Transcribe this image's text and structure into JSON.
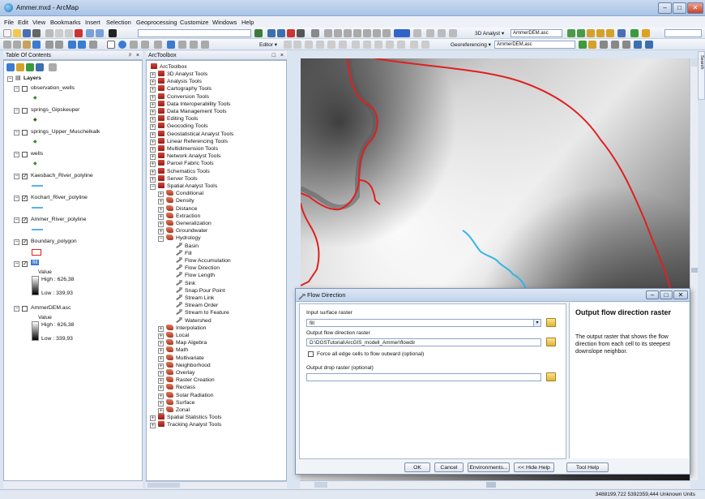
{
  "window": {
    "title": "Ammer.mxd - ArcMap"
  },
  "menu": [
    "File",
    "Edit",
    "View",
    "Bookmarks",
    "Insert",
    "Selection",
    "Geoprocessing",
    "Customize",
    "Windows",
    "Help"
  ],
  "toolbar": {
    "analyst_3d": "3D Analyst ▾",
    "layer_combo": "AmmerDEM.asc",
    "editor": "Editor ▾",
    "georeferencing": "Georeferencing ▾",
    "geo_layer": "AmmerDEM.asc"
  },
  "toc": {
    "title": "Table Of Contents",
    "root": "Layers",
    "layers": [
      {
        "name": "observation_wells",
        "checked": false,
        "symbol": "point"
      },
      {
        "name": "springs_Gipskeuper",
        "checked": false,
        "symbol": "point"
      },
      {
        "name": "springs_Upper_Muschelkalk",
        "checked": false,
        "symbol": "point"
      },
      {
        "name": "wells",
        "checked": false,
        "symbol": "point"
      },
      {
        "name": "Kaesbach_River_polyline",
        "checked": true,
        "symbol": "line"
      },
      {
        "name": "Kochart_River_polyline",
        "checked": true,
        "symbol": "line"
      },
      {
        "name": "Ammer_River_polyline",
        "checked": true,
        "symbol": "line"
      },
      {
        "name": "Boundary_polygon",
        "checked": true,
        "symbol": "polygon"
      }
    ],
    "fill_layer": {
      "name": "fill",
      "value_label": "Value",
      "high": "High : 626,38",
      "low": "Low : 339,93"
    },
    "dem_layer": {
      "name": "AmmerDEM.asc",
      "value_label": "Value",
      "high": "High : 626,38",
      "low": "Low : 339,93"
    }
  },
  "arctoolbox": {
    "title": "ArcToolbox",
    "root": "ArcToolbox",
    "toolboxes_top": [
      "3D Analyst Tools",
      "Analysis Tools",
      "Cartography Tools",
      "Conversion Tools",
      "Data Interoperability Tools",
      "Data Management Tools",
      "Editing Tools",
      "Geocoding Tools",
      "Geostatistical Analyst Tools",
      "Linear Referencing Tools",
      "Multidimension Tools",
      "Network Analyst Tools",
      "Parcel Fabric Tools",
      "Schematics Tools",
      "Server Tools"
    ],
    "spatial_analyst": "Spatial Analyst Tools",
    "sa_sets_before": [
      "Conditional",
      "Density",
      "Distance",
      "Extraction",
      "Generalization",
      "Groundwater"
    ],
    "hydrology": "Hydrology",
    "hydrology_tools": [
      "Basin",
      "Fill",
      "Flow Accumulation",
      "Flow Direction",
      "Flow Length",
      "Sink",
      "Snap Pour Point",
      "Stream Link",
      "Stream Order",
      "Stream to Feature",
      "Watershed"
    ],
    "sa_sets_after": [
      "Interpolation",
      "Local",
      "Map Algebra",
      "Math",
      "Multivariate",
      "Neighborhood",
      "Overlay",
      "Raster Creation",
      "Reclass",
      "Solar Radiation",
      "Surface",
      "Zonal"
    ],
    "toolboxes_bottom": [
      "Spatial Statistics Tools",
      "Tracking Analyst Tools"
    ]
  },
  "dialog": {
    "title": "Flow Direction",
    "input_label": "Input surface raster",
    "input_value": "fill",
    "output_label": "Output flow direction raster",
    "output_value": "D:\\DGSTutorial\\ArcGIS_modell_Ammer\\flowdir",
    "force_label": "Force all edge cells to flow outward (optional)",
    "drop_label": "Output drop raster (optional)",
    "drop_value": "",
    "help_title": "Output flow direction raster",
    "help_text": "The output raster that shows the flow direction from each cell to its steepest downslope neighbor.",
    "buttons": {
      "ok": "OK",
      "cancel": "Cancel",
      "env": "Environments...",
      "hide_help": "<< Hide Help",
      "tool_help": "Tool Help"
    }
  },
  "side_tab": "Search",
  "status": {
    "coords": "3488199,722  5392359,444 Unknown Units"
  },
  "colors": {
    "boundary": "#e02020",
    "river": "#33b5e5",
    "titlebar": "#c2d4ec"
  }
}
